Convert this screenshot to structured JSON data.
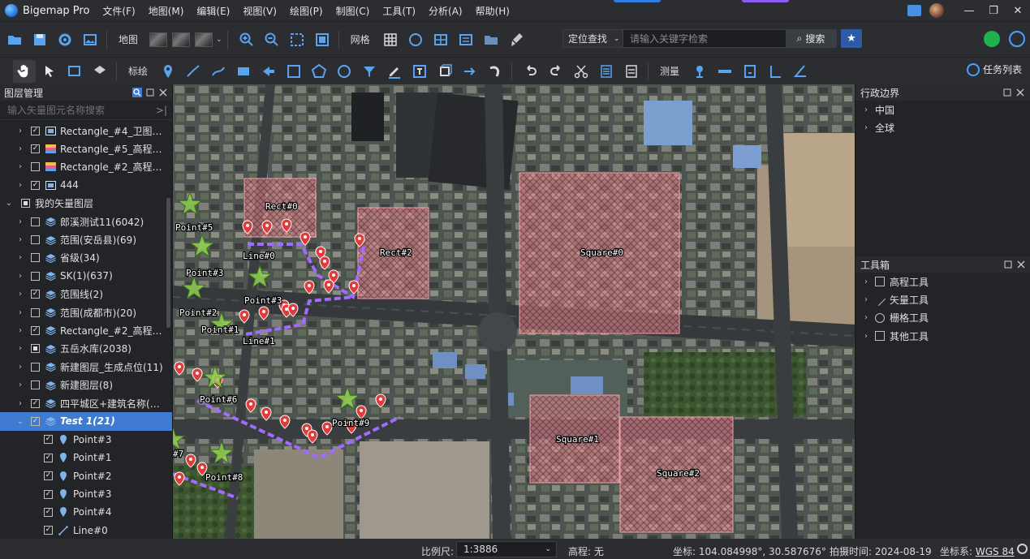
{
  "app": {
    "title": "Bigemap Pro"
  },
  "menu": [
    "文件(F)",
    "地图(M)",
    "编辑(E)",
    "视图(V)",
    "绘图(P)",
    "制图(C)",
    "工具(T)",
    "分析(A)",
    "帮助(H)"
  ],
  "toolbar1": {
    "map_label": "地图",
    "grid_label": "网格",
    "locate_select": "定位查找",
    "search_placeholder": "请输入关键字检索",
    "search_button": "搜索"
  },
  "toolbar2": {
    "mark_label": "标绘",
    "measure_label": "测量",
    "task_list": "任务列表"
  },
  "layer_panel": {
    "title": "图层管理",
    "search_placeholder": "输入矢量图元名称搜索",
    "rows": [
      {
        "name": "Rectangle_#4_卫图_Le...",
        "indent": 1,
        "expand": "›",
        "check": "✓",
        "icon": "raster"
      },
      {
        "name": "Rectangle_#5_高程_Le...",
        "indent": 1,
        "expand": "›",
        "check": "✓",
        "icon": "elev"
      },
      {
        "name": "Rectangle_#2_高程33_...",
        "indent": 1,
        "expand": "›",
        "check": "",
        "icon": "elev"
      },
      {
        "name": "444",
        "indent": 1,
        "expand": "›",
        "check": "✓",
        "icon": "raster"
      },
      {
        "name": "我的矢量图层",
        "indent": 0,
        "expand": "⌄",
        "check": "partial",
        "icon": ""
      },
      {
        "name": "郎溪测试11(6042)",
        "indent": 1,
        "expand": "›",
        "check": "",
        "icon": "layers"
      },
      {
        "name": "范围(安岳县)(69)",
        "indent": 1,
        "expand": "›",
        "check": "",
        "icon": "layers"
      },
      {
        "name": "省级(34)",
        "indent": 1,
        "expand": "›",
        "check": "",
        "icon": "layers"
      },
      {
        "name": "SK(1)(637)",
        "indent": 1,
        "expand": "›",
        "check": "",
        "icon": "layers"
      },
      {
        "name": "范围线(2)",
        "indent": 1,
        "expand": "›",
        "check": "✓",
        "icon": "layers"
      },
      {
        "name": "范围(成都市)(20)",
        "indent": 1,
        "expand": "›",
        "check": "",
        "icon": "layers"
      },
      {
        "name": "Rectangle_#2_高程33_...",
        "indent": 1,
        "expand": "›",
        "check": "✓",
        "icon": "layers"
      },
      {
        "name": "五岳水库(2038)",
        "indent": 1,
        "expand": "›",
        "check": "partial",
        "icon": "layers"
      },
      {
        "name": "新建图层_生成点位(11)",
        "indent": 1,
        "expand": "›",
        "check": "",
        "icon": "layers"
      },
      {
        "name": "新建图层(8)",
        "indent": 1,
        "expand": "›",
        "check": "",
        "icon": "layers"
      },
      {
        "name": "四平城区+建筑名称(97...",
        "indent": 1,
        "expand": "›",
        "check": "✓",
        "icon": "layers"
      },
      {
        "name": "Test 1(21)",
        "indent": 1,
        "expand": "⌄",
        "check": "✓",
        "icon": "layers",
        "selected": true
      },
      {
        "name": "Point#3",
        "indent": 2,
        "expand": "",
        "check": "✓",
        "icon": "pin"
      },
      {
        "name": "Point#1",
        "indent": 2,
        "expand": "",
        "check": "✓",
        "icon": "pin"
      },
      {
        "name": "Point#2",
        "indent": 2,
        "expand": "",
        "check": "✓",
        "icon": "pin"
      },
      {
        "name": "Point#3",
        "indent": 2,
        "expand": "",
        "check": "✓",
        "icon": "pin"
      },
      {
        "name": "Point#4",
        "indent": 2,
        "expand": "",
        "check": "✓",
        "icon": "pin"
      },
      {
        "name": "Line#0",
        "indent": 2,
        "expand": "",
        "check": "✓",
        "icon": "line"
      }
    ]
  },
  "map": {
    "rect_labels": [
      "Rect#0",
      "Rect#2",
      "Square#0",
      "Square#1",
      "Square#2"
    ],
    "point_labels": [
      "Point#5",
      "Point#3",
      "Point#3",
      "Point#2",
      "Point#1",
      "Point#6",
      "Point#9",
      "Point#8",
      "#7"
    ],
    "line_labels": [
      "Line#0",
      "Line#1"
    ]
  },
  "admin_panel": {
    "title": "行政边界",
    "items": [
      "中国",
      "全球"
    ]
  },
  "toolbox": {
    "title": "工具箱",
    "items": [
      "高程工具",
      "矢量工具",
      "栅格工具",
      "其他工具"
    ]
  },
  "status": {
    "scale_label": "比例尺:",
    "scale_value": "1:3886",
    "elevation": "高程: 无",
    "coordinates": "坐标: 104.084998°, 30.587676°",
    "capture_date": "拍摄时间: 2024-08-19",
    "crs_label": "坐标系:",
    "crs_value": "WGS 84"
  },
  "colors": {
    "accent": "#3e7bd1",
    "route": "#9b59f5",
    "rect_fill": "#f28c98",
    "pin": "#e23b3b",
    "star": "#8fd14f"
  }
}
